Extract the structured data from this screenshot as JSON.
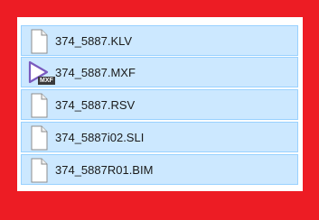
{
  "files": [
    {
      "name": "374_5887.KLV",
      "icon": "document-icon"
    },
    {
      "name": "374_5887.MXF",
      "icon": "video-play-icon",
      "badge": "MXF"
    },
    {
      "name": "374_5887.RSV",
      "icon": "document-icon"
    },
    {
      "name": "374_5887i02.SLI",
      "icon": "document-icon"
    },
    {
      "name": "374_5887R01.BIM",
      "icon": "document-icon"
    }
  ],
  "colors": {
    "background": "#ed1c24",
    "panel": "#ffffff",
    "row_fill": "#cce8ff",
    "row_border": "#99d1ff",
    "play_accent": "#7a5bbf"
  }
}
